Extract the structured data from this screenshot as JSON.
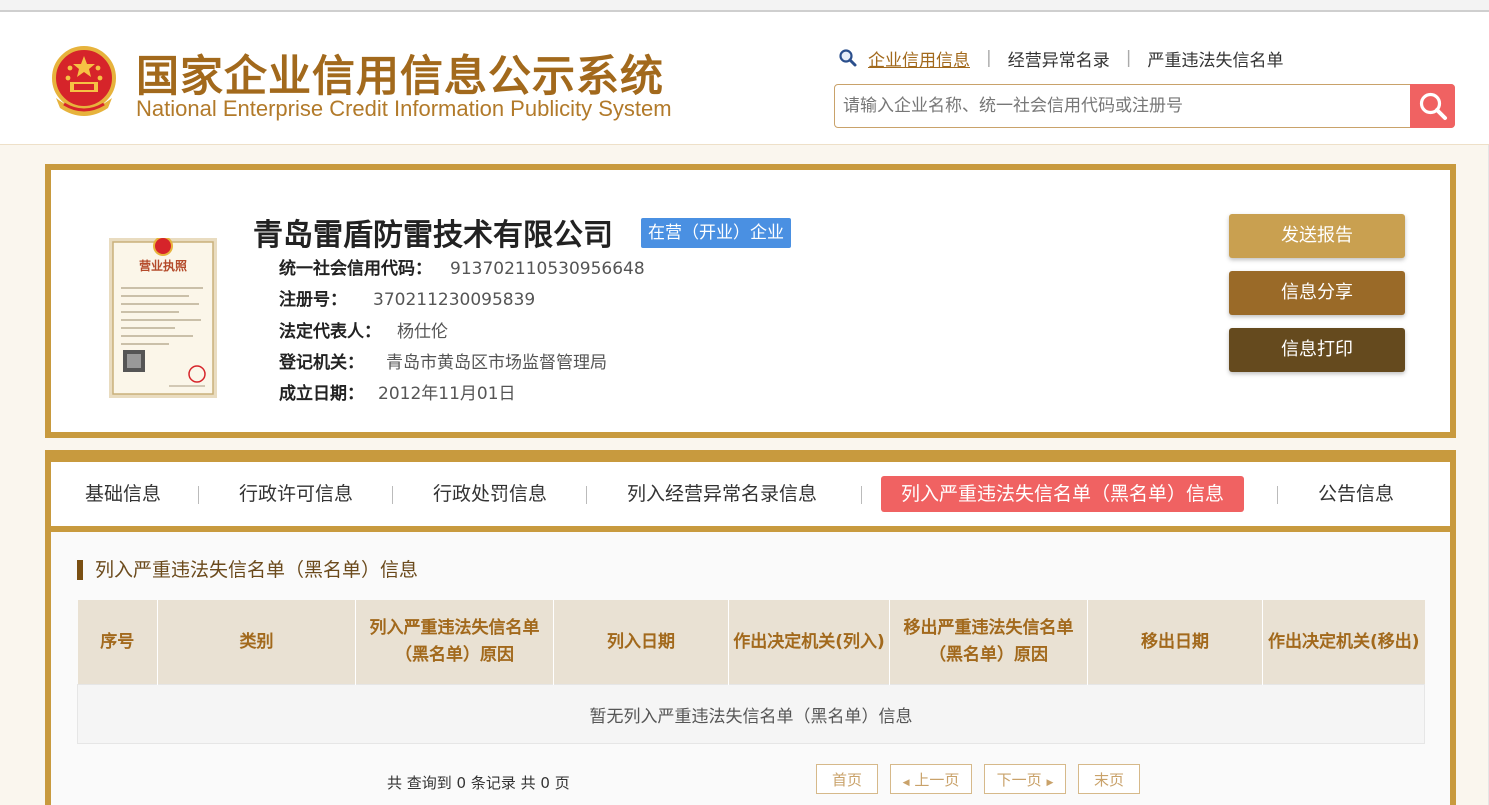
{
  "header": {
    "title_cn": "国家企业信用信息公示系统",
    "title_en": "National Enterprise Credit Information Publicity System",
    "search_links": [
      "企业信用信息",
      "经营异常名录",
      "严重违法失信名单"
    ],
    "search_placeholder": "请输入企业名称、统一社会信用代码或注册号"
  },
  "company": {
    "name": "青岛雷盾防雷技术有限公司",
    "status": "在营（开业）企业",
    "license_image_title": "营业执照",
    "fields": [
      {
        "label": "统一社会信用代码：",
        "value": "913702110530956648"
      },
      {
        "label": "注册号：",
        "value": "370211230095839"
      },
      {
        "label": "法定代表人：",
        "value": "杨仕伦"
      },
      {
        "label": "登记机关：",
        "value": "青岛市黄岛区市场监督管理局"
      },
      {
        "label": "成立日期：",
        "value": "2012年11月01日"
      }
    ]
  },
  "actions": {
    "send_report": "发送报告",
    "share": "信息分享",
    "print": "信息打印"
  },
  "tabs": [
    "基础信息",
    "行政许可信息",
    "行政处罚信息",
    "列入经营异常名录信息",
    "列入严重违法失信名单（黑名单）信息",
    "公告信息"
  ],
  "active_tab": "列入严重违法失信名单（黑名单）信息",
  "section": {
    "title": "列入严重违法失信名单（黑名单）信息",
    "columns": [
      "序号",
      "类别",
      "列入严重违法失信名单（黑名单）原因",
      "列入日期",
      "作出决定机关(列入)",
      "移出严重违法失信名单（黑名单）原因",
      "移出日期",
      "作出决定机关(移出)"
    ],
    "empty_message": "暂无列入严重违法失信名单（黑名单）信息"
  },
  "pager": {
    "summary": "共 查询到 0 条记录 共 0 页",
    "first": "首页",
    "prev": "上一页",
    "next": "下一页",
    "last": "末页"
  },
  "colors": {
    "brand_gold": "#c89a3e",
    "title_brown": "#a2691c",
    "accent_red": "#f06262",
    "badge_blue": "#4a90e2",
    "btn_send": "#c9a050",
    "btn_share": "#9a6a28",
    "btn_print": "#654a1e"
  }
}
